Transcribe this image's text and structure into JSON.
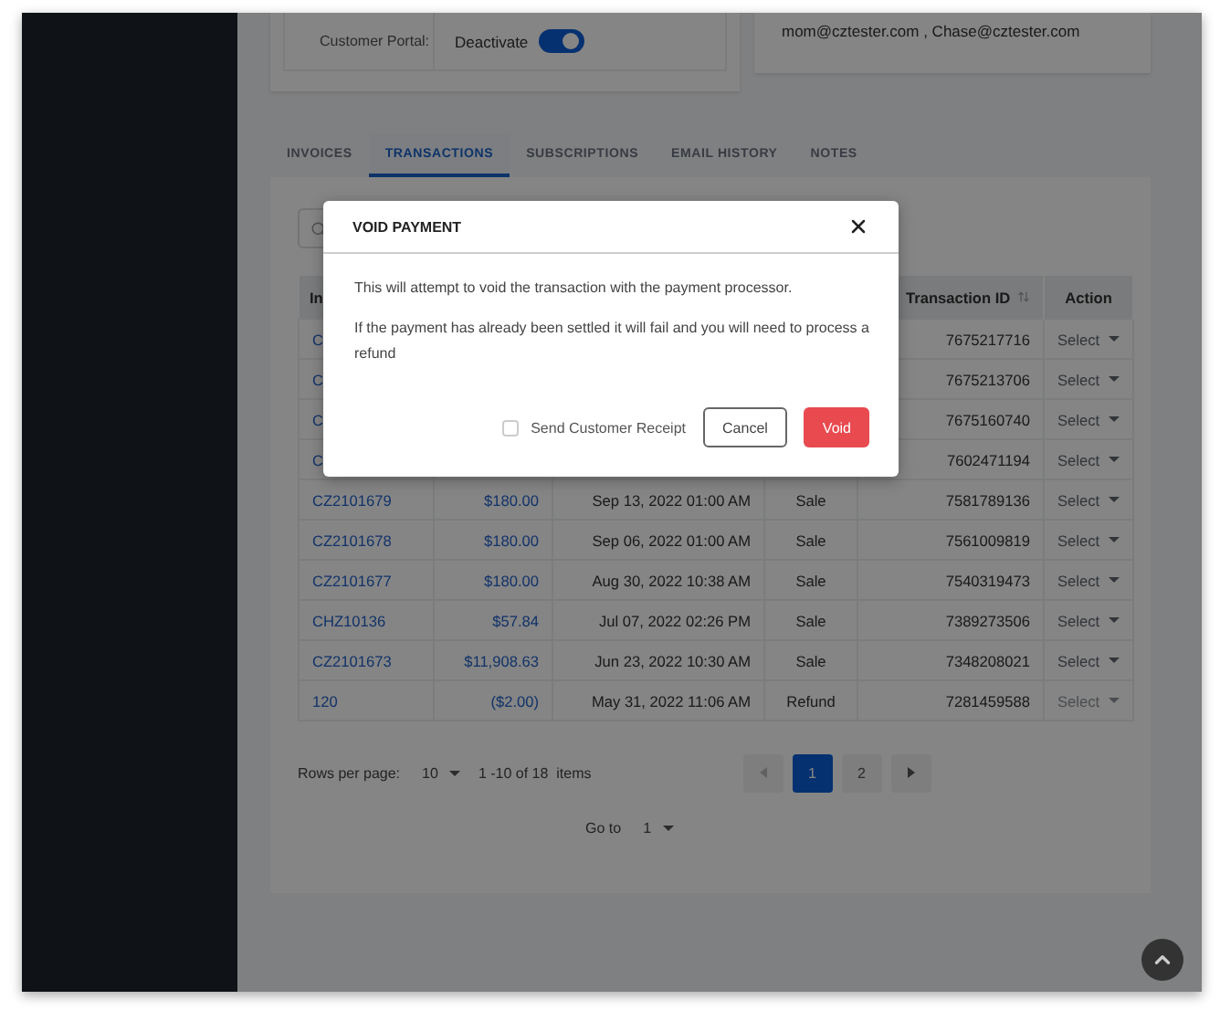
{
  "customer_portal": {
    "label": "Customer Portal:",
    "toggle_label": "Deactivate",
    "on": true
  },
  "contact_card": {
    "emails": "mom@cztester.com , Chase@cztester.com"
  },
  "tabs": [
    {
      "label": "INVOICES",
      "selected": false
    },
    {
      "label": "TRANSACTIONS",
      "selected": true
    },
    {
      "label": "SUBSCRIPTIONS",
      "selected": false
    },
    {
      "label": "EMAIL HISTORY",
      "selected": false
    },
    {
      "label": "NOTES",
      "selected": false
    }
  ],
  "table": {
    "columns": [
      "In",
      null,
      null,
      null,
      "Transaction ID",
      "Action"
    ],
    "rows": [
      {
        "invoice": "C",
        "transaction_id": "7675217716",
        "action": "Select",
        "disabled": false
      },
      {
        "invoice": "C",
        "transaction_id": "7675213706",
        "action": "Select",
        "disabled": false
      },
      {
        "invoice": "C",
        "transaction_id": "7675160740",
        "action": "Select",
        "disabled": false
      },
      {
        "invoice": "C",
        "transaction_id": "7602471194",
        "action": "Select",
        "disabled": false
      },
      {
        "invoice": "CZ2101679",
        "amount": "$180.00",
        "date": "Sep 13, 2022 01:00 AM",
        "type": "Sale",
        "transaction_id": "7581789136",
        "action": "Select",
        "disabled": false
      },
      {
        "invoice": "CZ2101678",
        "amount": "$180.00",
        "date": "Sep 06, 2022 01:00 AM",
        "type": "Sale",
        "transaction_id": "7561009819",
        "action": "Select",
        "disabled": false
      },
      {
        "invoice": "CZ2101677",
        "amount": "$180.00",
        "date": "Aug 30, 2022 10:38 AM",
        "type": "Sale",
        "transaction_id": "7540319473",
        "action": "Select",
        "disabled": false
      },
      {
        "invoice": "CHZ10136",
        "amount": "$57.84",
        "date": "Jul 07, 2022 02:26 PM",
        "type": "Sale",
        "transaction_id": "7389273506",
        "action": "Select",
        "disabled": false
      },
      {
        "invoice": "CZ2101673",
        "amount": "$11,908.63",
        "date": "Jun 23, 2022 10:30 AM",
        "type": "Sale",
        "transaction_id": "7348208021",
        "action": "Select",
        "disabled": false
      },
      {
        "invoice": "120",
        "amount": "($2.00)",
        "date": "May 31, 2022 11:06 AM",
        "type": "Refund",
        "transaction_id": "7281459588",
        "action": "Select",
        "disabled": true
      }
    ]
  },
  "pagination": {
    "rows_label": "Rows per page:",
    "rows_value": "10",
    "range": "1 -10 of 18  items",
    "pages": [
      {
        "label": "1",
        "selected": true
      },
      {
        "label": "2",
        "selected": false
      }
    ],
    "goto_label": "Go to",
    "goto_value": "1"
  },
  "modal": {
    "title": "VOID PAYMENT",
    "paragraphs": [
      "This will attempt to void the transaction with the payment processor.",
      "If the payment has already been settled it will fail and you will need to process a refund"
    ],
    "checkbox": {
      "label": "Send Customer Receipt",
      "checked": false
    },
    "buttons": [
      {
        "label": "Cancel",
        "kind": "secondary"
      },
      {
        "label": "Void",
        "kind": "danger"
      }
    ]
  }
}
